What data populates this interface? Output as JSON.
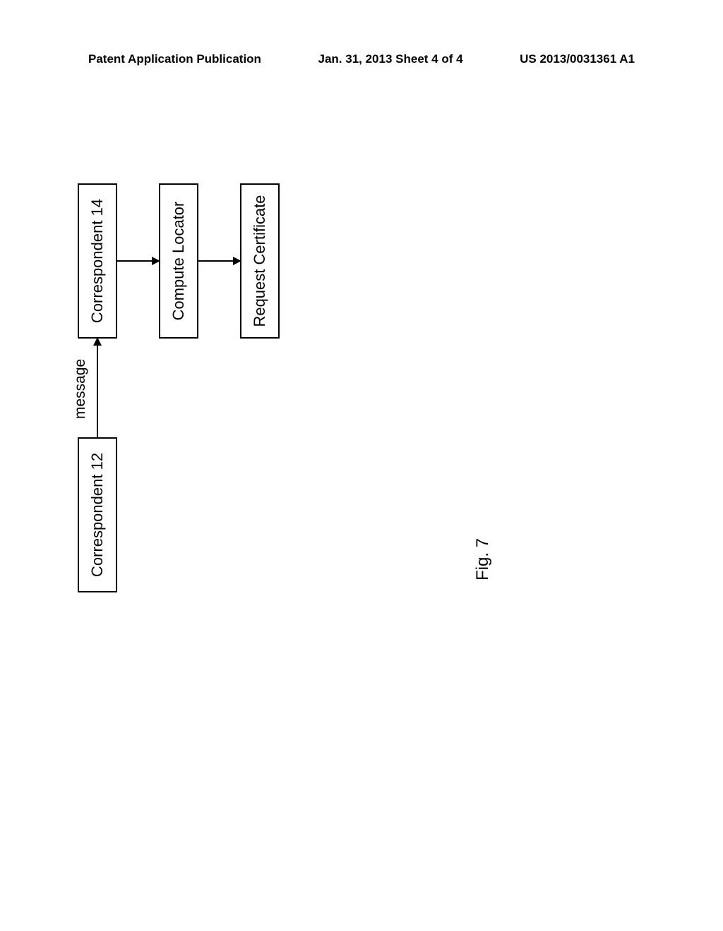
{
  "header": {
    "left": "Patent Application Publication",
    "center": "Jan. 31, 2013  Sheet 4 of 4",
    "right": "US 2013/0031361 A1"
  },
  "diagram": {
    "correspondent12": "Correspondent 12",
    "correspondent14": "Correspondent 14",
    "computeLocator": "Compute Locator",
    "requestCertificate": "Request Certificate",
    "message": "message"
  },
  "figureLabel": "Fig. 7"
}
